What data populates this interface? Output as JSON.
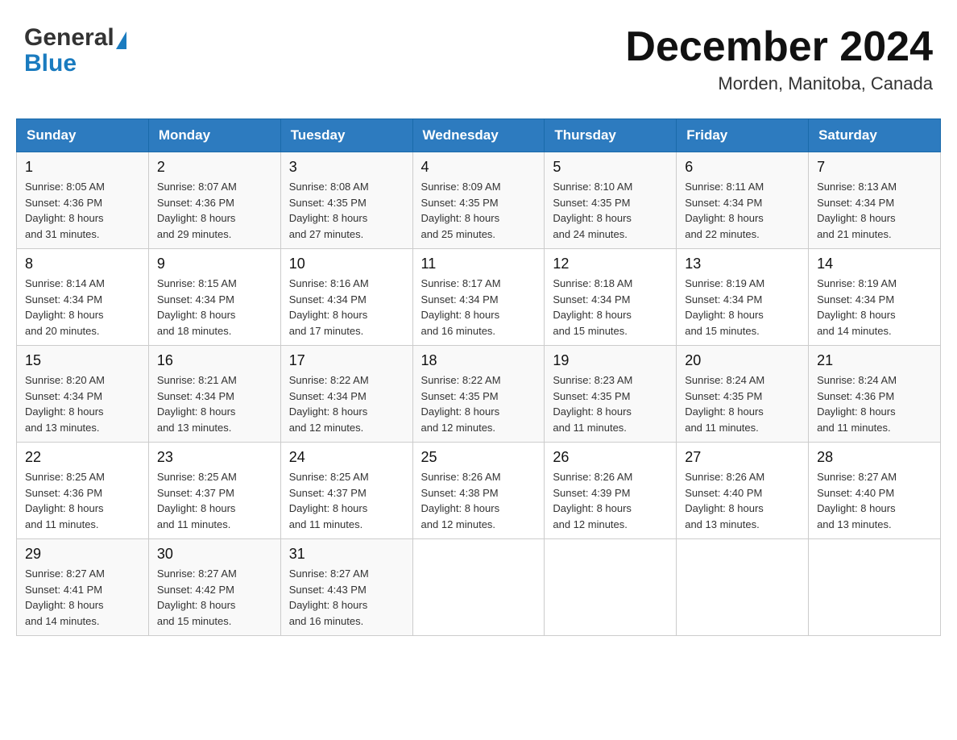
{
  "header": {
    "logo_general": "General",
    "logo_blue": "Blue",
    "month_title": "December 2024",
    "location": "Morden, Manitoba, Canada"
  },
  "weekdays": [
    "Sunday",
    "Monday",
    "Tuesday",
    "Wednesday",
    "Thursday",
    "Friday",
    "Saturday"
  ],
  "weeks": [
    [
      {
        "day": "1",
        "sunrise": "8:05 AM",
        "sunset": "4:36 PM",
        "daylight": "8 hours and 31 minutes."
      },
      {
        "day": "2",
        "sunrise": "8:07 AM",
        "sunset": "4:36 PM",
        "daylight": "8 hours and 29 minutes."
      },
      {
        "day": "3",
        "sunrise": "8:08 AM",
        "sunset": "4:35 PM",
        "daylight": "8 hours and 27 minutes."
      },
      {
        "day": "4",
        "sunrise": "8:09 AM",
        "sunset": "4:35 PM",
        "daylight": "8 hours and 25 minutes."
      },
      {
        "day": "5",
        "sunrise": "8:10 AM",
        "sunset": "4:35 PM",
        "daylight": "8 hours and 24 minutes."
      },
      {
        "day": "6",
        "sunrise": "8:11 AM",
        "sunset": "4:34 PM",
        "daylight": "8 hours and 22 minutes."
      },
      {
        "day": "7",
        "sunrise": "8:13 AM",
        "sunset": "4:34 PM",
        "daylight": "8 hours and 21 minutes."
      }
    ],
    [
      {
        "day": "8",
        "sunrise": "8:14 AM",
        "sunset": "4:34 PM",
        "daylight": "8 hours and 20 minutes."
      },
      {
        "day": "9",
        "sunrise": "8:15 AM",
        "sunset": "4:34 PM",
        "daylight": "8 hours and 18 minutes."
      },
      {
        "day": "10",
        "sunrise": "8:16 AM",
        "sunset": "4:34 PM",
        "daylight": "8 hours and 17 minutes."
      },
      {
        "day": "11",
        "sunrise": "8:17 AM",
        "sunset": "4:34 PM",
        "daylight": "8 hours and 16 minutes."
      },
      {
        "day": "12",
        "sunrise": "8:18 AM",
        "sunset": "4:34 PM",
        "daylight": "8 hours and 15 minutes."
      },
      {
        "day": "13",
        "sunrise": "8:19 AM",
        "sunset": "4:34 PM",
        "daylight": "8 hours and 15 minutes."
      },
      {
        "day": "14",
        "sunrise": "8:19 AM",
        "sunset": "4:34 PM",
        "daylight": "8 hours and 14 minutes."
      }
    ],
    [
      {
        "day": "15",
        "sunrise": "8:20 AM",
        "sunset": "4:34 PM",
        "daylight": "8 hours and 13 minutes."
      },
      {
        "day": "16",
        "sunrise": "8:21 AM",
        "sunset": "4:34 PM",
        "daylight": "8 hours and 13 minutes."
      },
      {
        "day": "17",
        "sunrise": "8:22 AM",
        "sunset": "4:34 PM",
        "daylight": "8 hours and 12 minutes."
      },
      {
        "day": "18",
        "sunrise": "8:22 AM",
        "sunset": "4:35 PM",
        "daylight": "8 hours and 12 minutes."
      },
      {
        "day": "19",
        "sunrise": "8:23 AM",
        "sunset": "4:35 PM",
        "daylight": "8 hours and 11 minutes."
      },
      {
        "day": "20",
        "sunrise": "8:24 AM",
        "sunset": "4:35 PM",
        "daylight": "8 hours and 11 minutes."
      },
      {
        "day": "21",
        "sunrise": "8:24 AM",
        "sunset": "4:36 PM",
        "daylight": "8 hours and 11 minutes."
      }
    ],
    [
      {
        "day": "22",
        "sunrise": "8:25 AM",
        "sunset": "4:36 PM",
        "daylight": "8 hours and 11 minutes."
      },
      {
        "day": "23",
        "sunrise": "8:25 AM",
        "sunset": "4:37 PM",
        "daylight": "8 hours and 11 minutes."
      },
      {
        "day": "24",
        "sunrise": "8:25 AM",
        "sunset": "4:37 PM",
        "daylight": "8 hours and 11 minutes."
      },
      {
        "day": "25",
        "sunrise": "8:26 AM",
        "sunset": "4:38 PM",
        "daylight": "8 hours and 12 minutes."
      },
      {
        "day": "26",
        "sunrise": "8:26 AM",
        "sunset": "4:39 PM",
        "daylight": "8 hours and 12 minutes."
      },
      {
        "day": "27",
        "sunrise": "8:26 AM",
        "sunset": "4:40 PM",
        "daylight": "8 hours and 13 minutes."
      },
      {
        "day": "28",
        "sunrise": "8:27 AM",
        "sunset": "4:40 PM",
        "daylight": "8 hours and 13 minutes."
      }
    ],
    [
      {
        "day": "29",
        "sunrise": "8:27 AM",
        "sunset": "4:41 PM",
        "daylight": "8 hours and 14 minutes."
      },
      {
        "day": "30",
        "sunrise": "8:27 AM",
        "sunset": "4:42 PM",
        "daylight": "8 hours and 15 minutes."
      },
      {
        "day": "31",
        "sunrise": "8:27 AM",
        "sunset": "4:43 PM",
        "daylight": "8 hours and 16 minutes."
      },
      null,
      null,
      null,
      null
    ]
  ]
}
